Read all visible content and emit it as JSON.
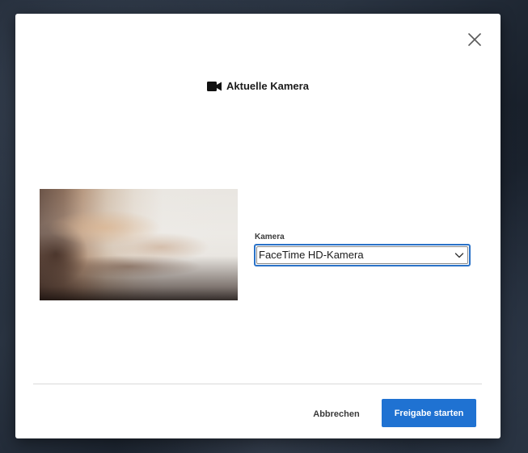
{
  "dialog": {
    "title": "Aktuelle Kamera",
    "title_icon": "video-camera-icon",
    "close_icon": "close-icon"
  },
  "camera": {
    "label": "Kamera",
    "selected": "FaceTime HD-Kamera",
    "chevron_icon": "chevron-down-icon"
  },
  "buttons": {
    "cancel": "Abbrechen",
    "start": "Freigabe starten"
  },
  "colors": {
    "primary": "#1f72d2",
    "focus": "#2a72c8",
    "text": "#1b1b1b"
  }
}
